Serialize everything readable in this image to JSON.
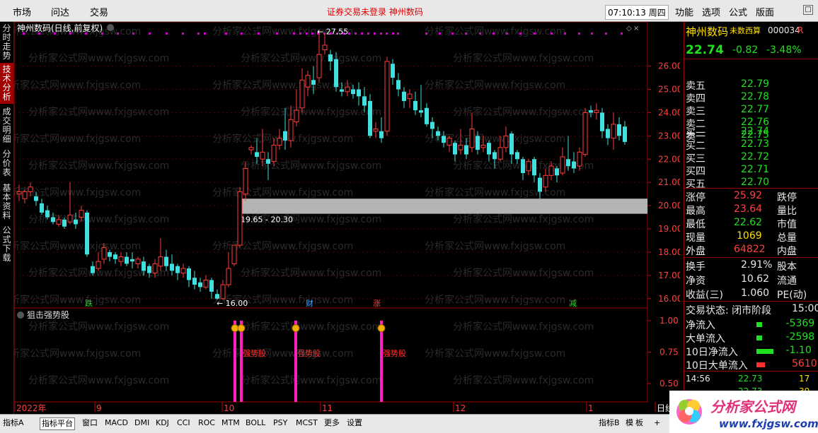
{
  "top": {
    "menu": [
      "市场",
      "问达",
      "交易"
    ],
    "warning": "证券交易未登录  神州数码",
    "clock": "07:10:13 周四",
    "right_menu": [
      "功能",
      "选项",
      "公式",
      "版面"
    ],
    "corner": "□"
  },
  "left_tabs": [
    "分时走势",
    "技术分析",
    "成交明细",
    "分价表",
    "基本资料",
    "公式下载"
  ],
  "chart": {
    "title": "神州数码(日线,前复权)",
    "price_axis": [
      "26.00",
      "25.00",
      "24.00",
      "23.00",
      "22.00",
      "21.00",
      "20.00",
      "19.00",
      "18.00",
      "17.00",
      "16.00"
    ],
    "high_label": "27.55",
    "low_label": "16.00",
    "band_label": "19.65 - 20.30",
    "event_tags": [
      {
        "t": "跌",
        "c": "#20e020"
      },
      {
        "t": "财",
        "c": "#4aa8ff"
      },
      {
        "t": "涨",
        "c": "#ff4040"
      },
      {
        "t": "减",
        "c": "#20e020"
      }
    ],
    "indicator_name": "狙击强势股",
    "indicator_axis": [
      "1.00",
      "0.75",
      "0.50"
    ],
    "signal_labels": [
      "强势股",
      "强势股",
      "强势股"
    ],
    "date_axis": [
      "2022年",
      "9",
      "10",
      "11",
      "12",
      "1",
      "日线"
    ],
    "watermark": "分析家公式网www.fxjgsw.com"
  },
  "chart_data": {
    "type": "candlestick",
    "title": "神州数码(日线,前复权)",
    "ylim": [
      15.6,
      27.9
    ],
    "annotations": {
      "high": 27.55,
      "low": 16.0,
      "band": [
        19.65,
        20.3
      ]
    }
  },
  "bottom_tabs": [
    "指标A",
    "指标平台",
    "窗口",
    "MACD",
    "DMI",
    "KDJ",
    "CCI",
    "ROC",
    "MTM",
    "BOLL",
    "PSY",
    "MCST",
    "更多",
    "设置"
  ],
  "bottom_right_tabs": [
    "指标B",
    "模",
    "板",
    "+"
  ],
  "quote": {
    "name": "神州数码",
    "mode": "未数西算",
    "code": "000034",
    "suffix": "R",
    "price": "22.74",
    "change": "-0.82",
    "pct": "-3.48%",
    "asks": [
      {
        "l": "卖五",
        "p": "22.79"
      },
      {
        "l": "卖四",
        "p": "22.78"
      },
      {
        "l": "卖三",
        "p": "22.77"
      },
      {
        "l": "卖二",
        "p": "22.76"
      },
      {
        "l": "卖一",
        "p": "22.75"
      }
    ],
    "bids": [
      {
        "l": "买一",
        "p": "22.74"
      },
      {
        "l": "买二",
        "p": "22.73"
      },
      {
        "l": "买三",
        "p": "22.72"
      },
      {
        "l": "买四",
        "p": "22.71"
      },
      {
        "l": "买五",
        "p": "22.70"
      }
    ],
    "stats": [
      {
        "l": "涨停",
        "v": "25.92",
        "c": "red",
        "r": "跌停"
      },
      {
        "l": "最高",
        "v": "23.64",
        "c": "red",
        "r": "量比"
      },
      {
        "l": "最低",
        "v": "22.62",
        "c": "green",
        "r": "市值"
      },
      {
        "l": "现量",
        "v": "1069",
        "c": "yellow",
        "r": "总量"
      },
      {
        "l": "外盘",
        "v": "64822",
        "c": "red",
        "r": "内盘"
      }
    ],
    "stats2": [
      {
        "l": "换手",
        "v": "2.91%",
        "r": "股本"
      },
      {
        "l": "净资",
        "v": "10.62",
        "r": "流通"
      },
      {
        "l": "收益(三)",
        "v": "1.060",
        "r": "PE(动)"
      }
    ],
    "status_label": "交易状态: 闭市阶段",
    "status_time": "15:00",
    "flows": [
      {
        "l": "净流入",
        "v": "-5369",
        "c": "green",
        "w": 8
      },
      {
        "l": "大单流入",
        "v": "-2598",
        "c": "green",
        "w": 8
      },
      {
        "l": "10日净流入",
        "v": "-1.10",
        "c": "green",
        "w": 24
      },
      {
        "l": "10日大单流入",
        "v": "5610",
        "c": "red",
        "w": 12
      }
    ],
    "tick_time": "14:56",
    "tick_price": "22.73",
    "tick_vol": "17",
    "tick_price2": "22.73",
    "tick_vol2": "39"
  },
  "logo": {
    "title": "分析家公式网",
    "url": "www.fxjgsw.com"
  }
}
